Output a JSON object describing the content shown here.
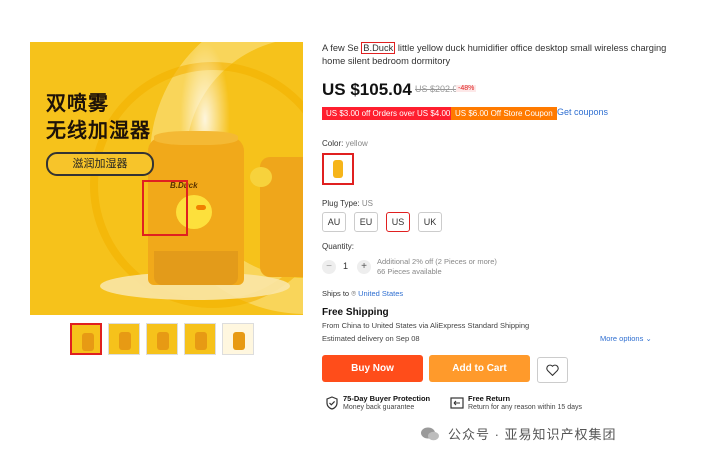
{
  "gallery": {
    "promo_line1": "双喷雾",
    "promo_line2": "无线加湿器",
    "promo_pill": "滋润加湿器",
    "device_brand": "B.Duck",
    "thumbnail_count": 5
  },
  "product": {
    "title_before": "A few Se ",
    "title_brand": "B.Duck",
    "title_after": " little yellow duck humidifier office desktop small wireless charging home silent bedroom dormitory",
    "price": "US $105.04",
    "original_price": "US $202.00",
    "discount": "-48%"
  },
  "coupons": {
    "coupon1": "US $3.00 off Orders over US $4.00",
    "coupon2": "US $6.00 Off Store Coupon",
    "get_coupons": "Get coupons"
  },
  "color": {
    "label": "Color:",
    "value": "yellow"
  },
  "plug": {
    "label": "Plug Type:",
    "value": "US",
    "options": [
      "AU",
      "EU",
      "US",
      "UK"
    ],
    "selected": "US"
  },
  "quantity": {
    "label": "Quantity:",
    "value": "1",
    "minus": "−",
    "plus": "+",
    "note_line1": "Additional 2% off (2 Pieces or more)",
    "note_line2": "66 Pieces available"
  },
  "shipping": {
    "ships_to_label": "Ships to",
    "ships_to_country": "United States",
    "free_title": "Free Shipping",
    "route": "From China to United States via AliExpress Standard Shipping",
    "delivery": "Estimated delivery on Sep 08",
    "more_options": "More options ⌄"
  },
  "actions": {
    "buy_now": "Buy Now",
    "add_to_cart": "Add to Cart"
  },
  "guarantees": {
    "protection_title": "75-Day Buyer Protection",
    "protection_sub": "Money back guarantee",
    "return_title": "Free Return",
    "return_sub": "Return for any reason within 15 days"
  },
  "watermark": {
    "text": "公众号 · 亚易知识产权集团"
  },
  "colors": {
    "accent_red": "#ff4d1a",
    "accent_orange": "#ff9a2b",
    "link_blue": "#2f6fd1",
    "highlight_red": "#e02020"
  }
}
